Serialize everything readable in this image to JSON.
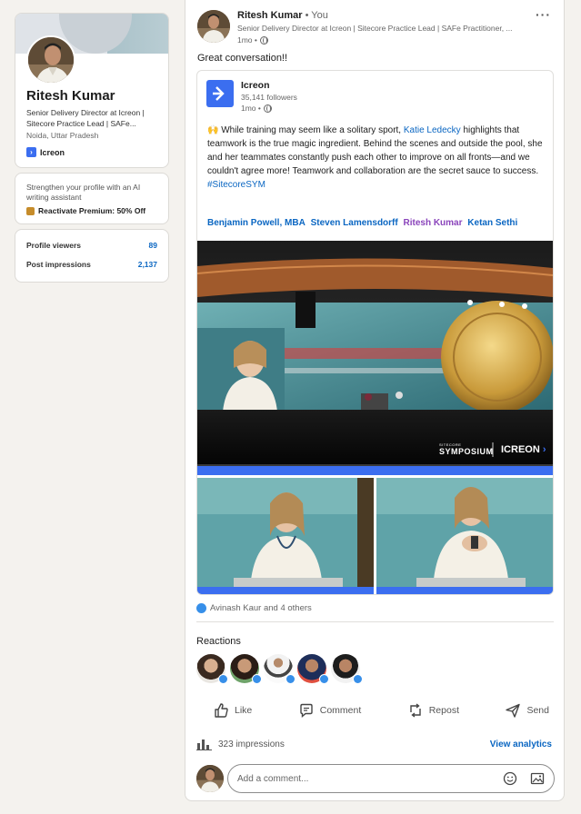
{
  "profile": {
    "name": "Ritesh Kumar",
    "headline": "Senior Delivery Director at Icreon | Sitecore Practice Lead | SAFe...",
    "location": "Noida, Uttar Pradesh",
    "company": "Icreon"
  },
  "premium": {
    "text": "Strengthen your profile with an AI writing assistant",
    "cta": "Reactivate Premium: 50% Off"
  },
  "stats": [
    {
      "label": "Profile viewers",
      "value": "89"
    },
    {
      "label": "Post impressions",
      "value": "2,137"
    }
  ],
  "post": {
    "author": "Ritesh Kumar",
    "you_tag": " • You",
    "author_sub": "Senior Delivery Director at Icreon | Sitecore Practice Lead | SAFe Practitioner, ...",
    "time": "1mo •",
    "text": "Great conversation!!",
    "shared": {
      "company": "Icreon",
      "followers": "35,141 followers",
      "time": "1mo •",
      "body_1": "🙌 While training may seem like a solitary sport, ",
      "body_link": "Katie Ledecky",
      "body_2": " highlights that teamwork is the true magic ingredient. Behind the scenes and outside the pool, she and her teammates constantly push each other to improve on all fronts—and we couldn't agree more! Teamwork and collaboration are the secret sauce to success. ",
      "hashtag": "#SitecoreSYM",
      "mentions": [
        "Benjamin Powell, MBA",
        "Steven Lamensdorff",
        "Ritesh Kumar",
        "Ketan Sethi"
      ],
      "image_brand": "SYMPOSIUM",
      "image_brand_small": "SITECORE",
      "image_partner": "ICREON"
    },
    "reactions_summary": "Avinash Kaur and 4 others",
    "reactions_title": "Reactions",
    "actions": {
      "like": "Like",
      "comment": "Comment",
      "repost": "Repost",
      "send": "Send"
    },
    "impressions": "323 impressions",
    "view_analytics": "View analytics",
    "comment_placeholder": "Add a comment..."
  },
  "colors": {
    "link": "#0a66c2",
    "mention_self": "#8a44bb",
    "icreon_blue": "#3b6ef0",
    "page_bg": "#f4f2ee"
  }
}
